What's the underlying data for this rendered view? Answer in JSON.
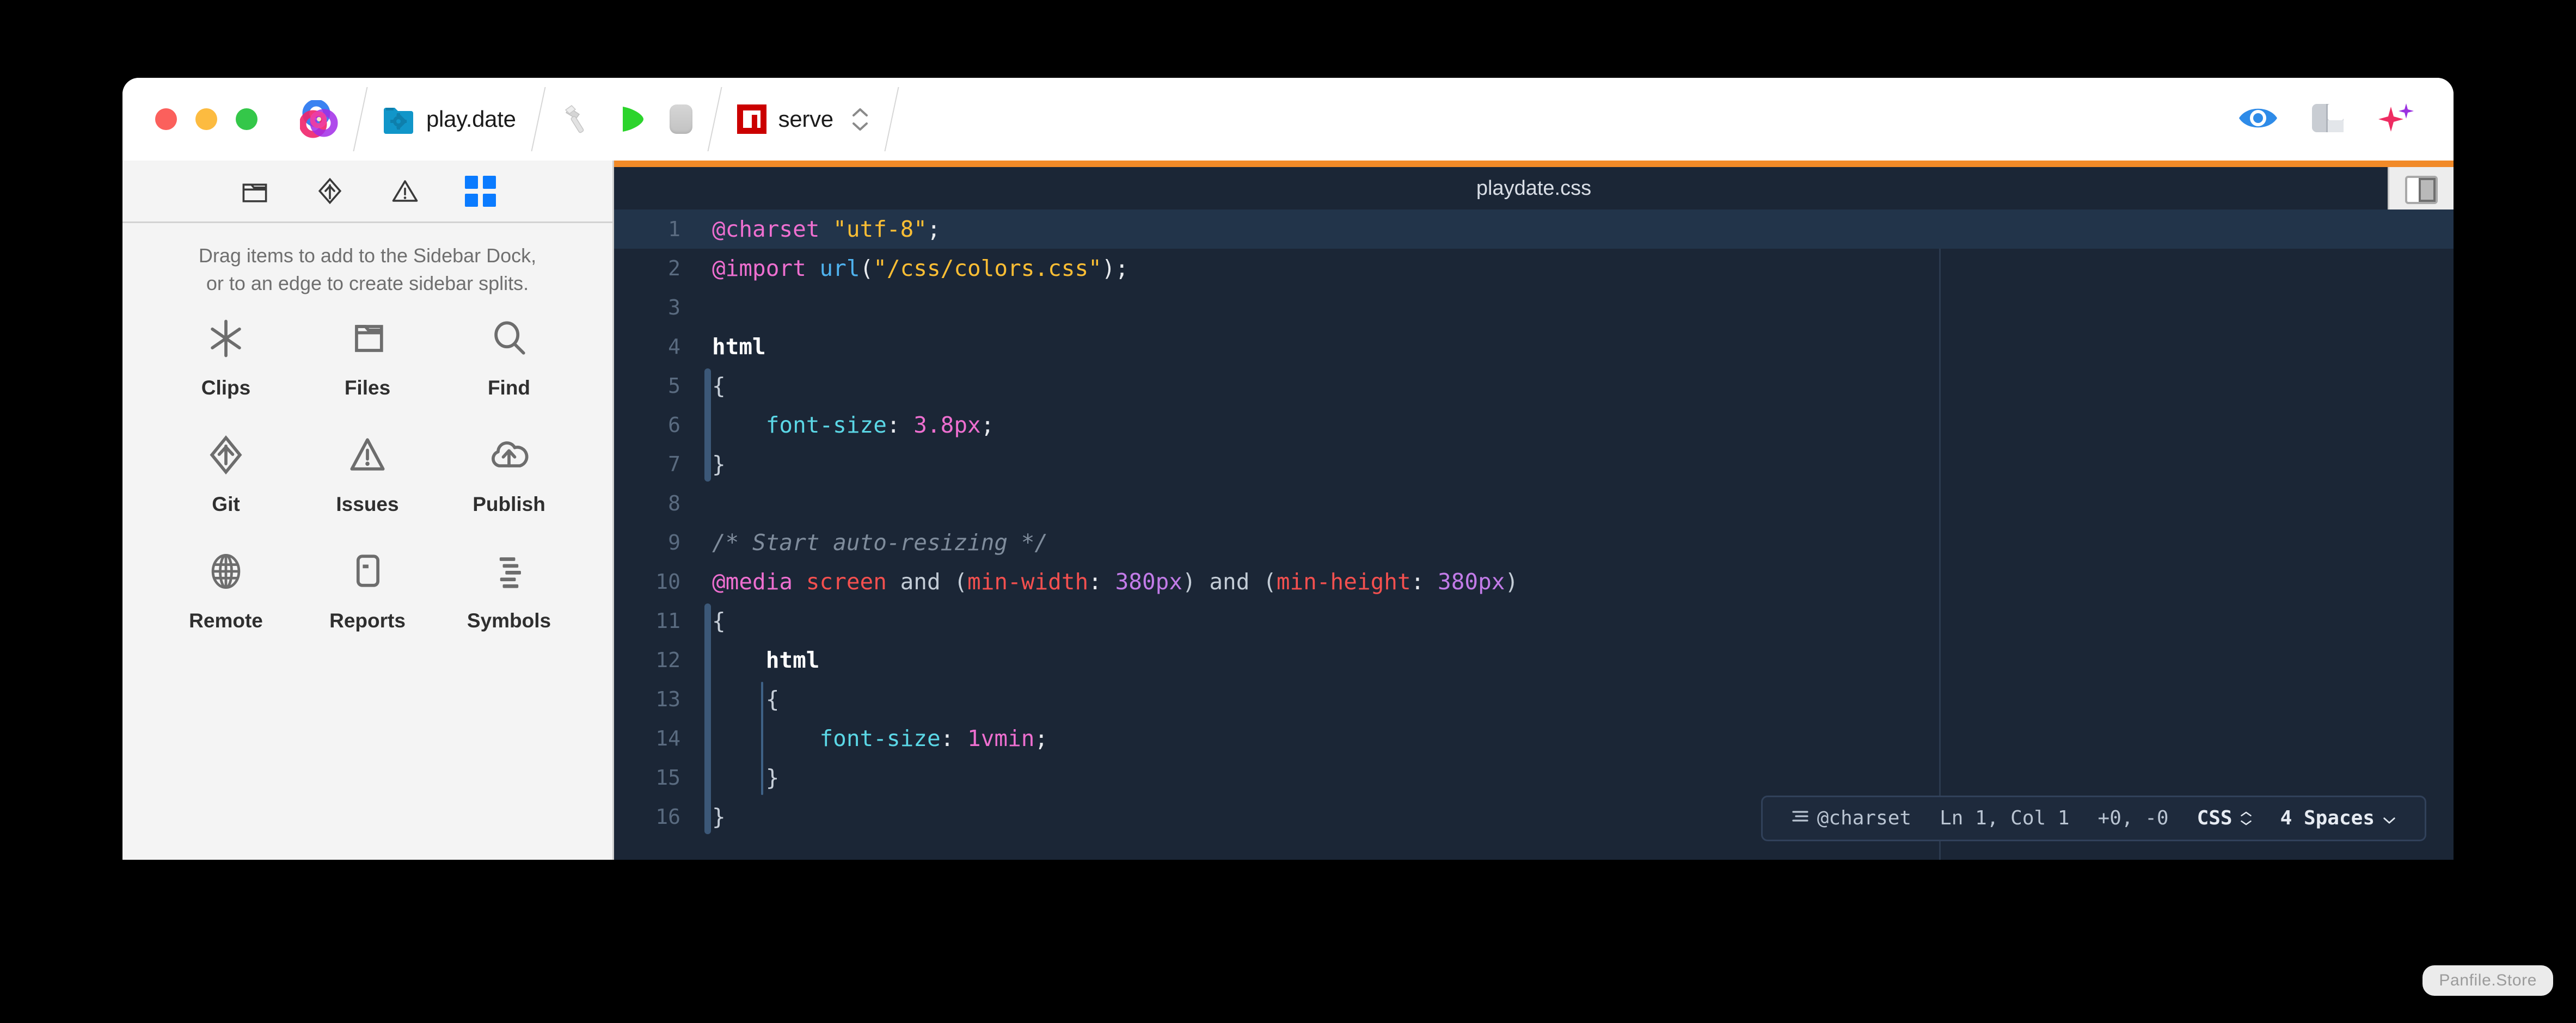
{
  "window": {
    "traffic_lights": [
      {
        "name": "close",
        "color": "#FB605C"
      },
      {
        "name": "minimize",
        "color": "#FCBB40"
      },
      {
        "name": "zoom",
        "color": "#34C749"
      }
    ]
  },
  "toolbar": {
    "app_icon": "nova-app-icon",
    "project": {
      "icon": "folder-gear-icon",
      "label": "play.date"
    },
    "build_icon": "hammer-icon",
    "run_icon": "play-icon",
    "stop_icon": "stop-icon",
    "task": {
      "icon": "npm-icon",
      "label": "serve",
      "stepper_icon": "chevron-up-down-icon"
    },
    "right_icons": [
      {
        "name": "preview-eye-icon"
      },
      {
        "name": "panel-layout-icon"
      },
      {
        "name": "sparkles-icon"
      }
    ]
  },
  "sidebar": {
    "tabs": [
      {
        "name": "files-tab",
        "icon": "folder-icon",
        "active": false
      },
      {
        "name": "git-tab",
        "icon": "git-diamond-icon",
        "active": false
      },
      {
        "name": "issues-tab",
        "icon": "warning-triangle-icon",
        "active": false
      },
      {
        "name": "dock-tab",
        "icon": "grid-icon",
        "active": true
      }
    ],
    "hint_line1": "Drag items to add to the Sidebar Dock,",
    "hint_line2": "or to an edge to create sidebar splits.",
    "dock_items": [
      {
        "label": "Clips",
        "icon": "asterisk-icon"
      },
      {
        "label": "Files",
        "icon": "folder-icon"
      },
      {
        "label": "Find",
        "icon": "magnifier-icon"
      },
      {
        "label": "Git",
        "icon": "git-diamond-icon"
      },
      {
        "label": "Issues",
        "icon": "warning-triangle-icon"
      },
      {
        "label": "Publish",
        "icon": "cloud-upload-icon"
      },
      {
        "label": "Remote",
        "icon": "globe-icon"
      },
      {
        "label": "Reports",
        "icon": "report-doc-icon"
      },
      {
        "label": "Symbols",
        "icon": "symbols-lines-icon"
      }
    ]
  },
  "editor": {
    "filename": "playdate.css",
    "accent_color": "#F18A28",
    "background_color": "#1B2636",
    "panel_toggle_icon": "right-sidebar-toggle-icon",
    "current_line": 1,
    "lines": [
      {
        "n": "1",
        "tokens": [
          {
            "t": "@charset",
            "c": "at"
          },
          {
            "t": " ",
            "c": "punc"
          },
          {
            "t": "\"utf-8\"",
            "c": "str"
          },
          {
            "t": ";",
            "c": "punc"
          }
        ]
      },
      {
        "n": "2",
        "tokens": [
          {
            "t": "@import",
            "c": "at"
          },
          {
            "t": " ",
            "c": "punc"
          },
          {
            "t": "url",
            "c": "fn"
          },
          {
            "t": "(",
            "c": "punc"
          },
          {
            "t": "\"/css/colors.css\"",
            "c": "str"
          },
          {
            "t": ");",
            "c": "punc"
          }
        ]
      },
      {
        "n": "3",
        "tokens": []
      },
      {
        "n": "4",
        "tokens": [
          {
            "t": "html",
            "c": "sel"
          }
        ]
      },
      {
        "n": "5",
        "tokens": [
          {
            "t": "{",
            "c": "brace"
          }
        ]
      },
      {
        "n": "6",
        "tokens": [
          {
            "t": "    ",
            "c": "punc"
          },
          {
            "t": "font-size",
            "c": "prop"
          },
          {
            "t": ": ",
            "c": "punc"
          },
          {
            "t": "3.8px",
            "c": "val"
          },
          {
            "t": ";",
            "c": "punc"
          }
        ]
      },
      {
        "n": "7",
        "tokens": [
          {
            "t": "}",
            "c": "brace"
          }
        ]
      },
      {
        "n": "8",
        "tokens": []
      },
      {
        "n": "9",
        "tokens": [
          {
            "t": "/* Start auto-resizing */",
            "c": "comment"
          }
        ]
      },
      {
        "n": "10",
        "tokens": [
          {
            "t": "@media",
            "c": "at"
          },
          {
            "t": " ",
            "c": "punc"
          },
          {
            "t": "screen",
            "c": "media-kw"
          },
          {
            "t": " ",
            "c": "punc"
          },
          {
            "t": "and",
            "c": "media-and"
          },
          {
            "t": " (",
            "c": "media-and"
          },
          {
            "t": "min-width",
            "c": "media-feat"
          },
          {
            "t": ": ",
            "c": "punc"
          },
          {
            "t": "380px",
            "c": "media-num"
          },
          {
            "t": ")",
            "c": "media-and"
          },
          {
            "t": " ",
            "c": "punc"
          },
          {
            "t": "and",
            "c": "media-and"
          },
          {
            "t": " (",
            "c": "media-and"
          },
          {
            "t": "min-height",
            "c": "media-feat"
          },
          {
            "t": ": ",
            "c": "punc"
          },
          {
            "t": "380px",
            "c": "media-num"
          },
          {
            "t": ")",
            "c": "media-and"
          }
        ]
      },
      {
        "n": "11",
        "tokens": [
          {
            "t": "{",
            "c": "brace"
          }
        ]
      },
      {
        "n": "12",
        "tokens": [
          {
            "t": "    ",
            "c": "punc"
          },
          {
            "t": "html",
            "c": "sel"
          }
        ]
      },
      {
        "n": "13",
        "tokens": [
          {
            "t": "    ",
            "c": "punc"
          },
          {
            "t": "{",
            "c": "brace"
          }
        ]
      },
      {
        "n": "14",
        "tokens": [
          {
            "t": "        ",
            "c": "punc"
          },
          {
            "t": "font-size",
            "c": "prop"
          },
          {
            "t": ": ",
            "c": "punc"
          },
          {
            "t": "1vmin",
            "c": "val"
          },
          {
            "t": ";",
            "c": "punc"
          }
        ]
      },
      {
        "n": "15",
        "tokens": [
          {
            "t": "    ",
            "c": "punc"
          },
          {
            "t": "}",
            "c": "brace"
          }
        ]
      },
      {
        "n": "16",
        "tokens": [
          {
            "t": "}",
            "c": "brace"
          }
        ]
      }
    ]
  },
  "status_bar": {
    "symbol_icon": "symbol-list-icon",
    "symbol": "@charset",
    "cursor": "Ln 1, Col 1",
    "diff": "+0, -0",
    "language": "CSS",
    "language_chevron": "chevron-up-down-icon",
    "indentation": "4 Spaces",
    "indentation_chevron": "chevron-down-icon"
  },
  "watermark": {
    "text": "Panfile.Store"
  }
}
